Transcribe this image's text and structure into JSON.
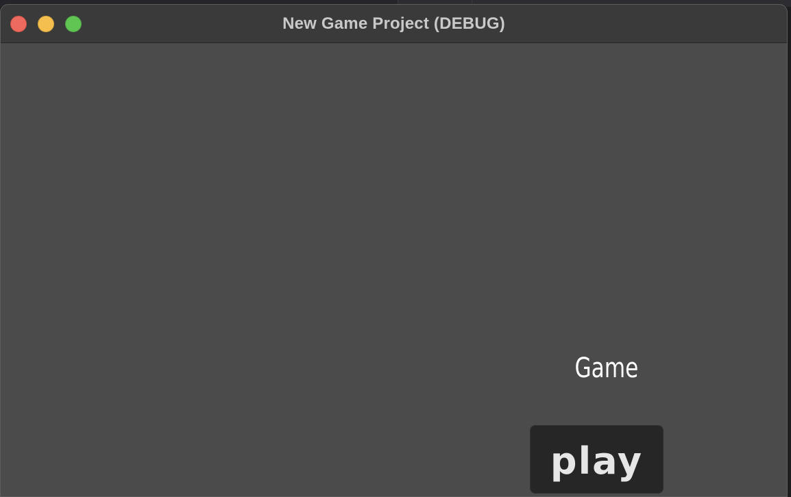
{
  "window": {
    "title": "New Game Project (DEBUG)"
  },
  "game": {
    "title_label": "Game",
    "play_button_label": "play"
  },
  "colors": {
    "close": "#ec6a5e",
    "minimize": "#f4bf4f",
    "maximize": "#61c554",
    "viewport_bg": "#4b4b4b",
    "button_bg": "#262626"
  }
}
